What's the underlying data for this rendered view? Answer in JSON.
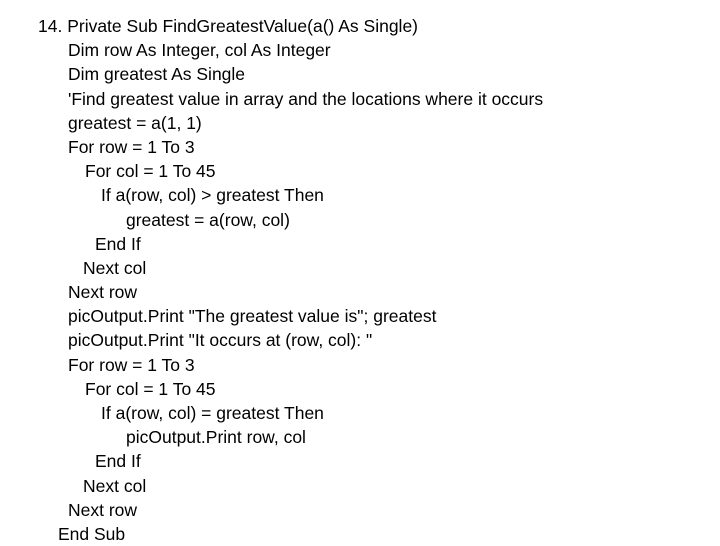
{
  "document": {
    "type": "code-listing",
    "language": "Visual Basic",
    "background_color": "#ffffff",
    "text_color": "#000000",
    "exercise_number": "14.",
    "lines": [
      {
        "indent": "ind-num",
        "text": "14. Private Sub FindGreatestValue(a() As Single)"
      },
      {
        "indent": "ind-0",
        "text": "Dim row As Integer, col As Integer"
      },
      {
        "indent": "ind-0",
        "text": "Dim greatest As Single"
      },
      {
        "indent": "ind-0",
        "text": "'Find greatest value in array and the locations where it occurs"
      },
      {
        "indent": "ind-0",
        "text": "greatest = a(1, 1)"
      },
      {
        "indent": "ind-0",
        "text": "For row = 1 To 3"
      },
      {
        "indent": "ind-1",
        "text": "For col = 1 To 45"
      },
      {
        "indent": "ind-2",
        "text": "If a(row, col) > greatest Then"
      },
      {
        "indent": "ind-3",
        "text": "greatest = a(row, col)"
      },
      {
        "indent": "ind-endif",
        "text": "End If"
      },
      {
        "indent": "ind-next1",
        "text": "Next col"
      },
      {
        "indent": "ind-0",
        "text": "Next row"
      },
      {
        "indent": "ind-0",
        "text": "picOutput.Print \"The greatest value is\"; greatest"
      },
      {
        "indent": "ind-0",
        "text": "picOutput.Print \"It occurs at (row, col): \""
      },
      {
        "indent": "ind-0",
        "text": "For row = 1 To 3"
      },
      {
        "indent": "ind-1",
        "text": "For col = 1 To 45"
      },
      {
        "indent": "ind-2",
        "text": "If a(row, col) = greatest Then"
      },
      {
        "indent": "ind-3",
        "text": "picOutput.Print row, col"
      },
      {
        "indent": "ind-endif",
        "text": "End If"
      },
      {
        "indent": "ind-next1",
        "text": "Next col"
      },
      {
        "indent": "ind-0",
        "text": "Next row"
      },
      {
        "indent": "ind-sub",
        "text": "End Sub"
      }
    ]
  }
}
